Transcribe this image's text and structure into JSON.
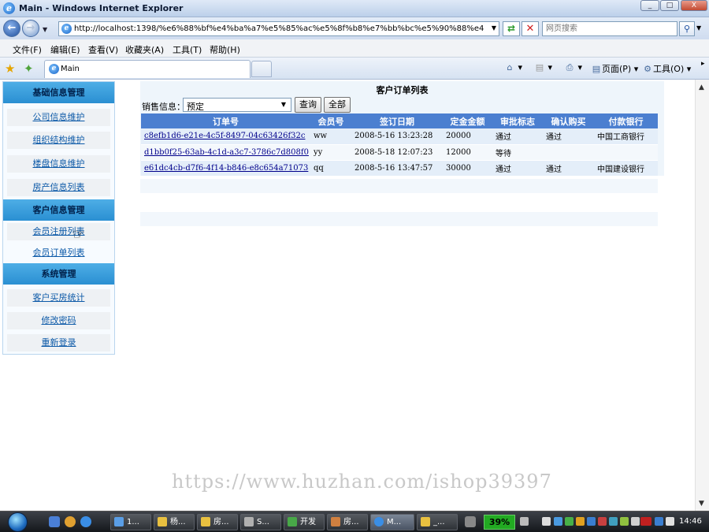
{
  "window": {
    "title": "Main - Windows Internet Explorer",
    "minimize": "_",
    "maximize": "□",
    "close": "X"
  },
  "address": {
    "url": "http://localhost:1398/%e6%88%bf%e4%ba%a7%e5%85%ac%e5%8f%b8%e7%bb%bc%e5%90%88%e4%bf%a1%e",
    "search_placeholder": "网页搜索"
  },
  "menu": [
    "文件(F)",
    "编辑(E)",
    "查看(V)",
    "收藏夹(A)",
    "工具(T)",
    "帮助(H)"
  ],
  "tab": {
    "title": "Main"
  },
  "commands": {
    "page": "页面(P)",
    "tools": "工具(O)"
  },
  "sidebar": {
    "sections": [
      {
        "title": "基础信息管理",
        "items": [
          "公司信息维护",
          "组织结构维护",
          "楼盘信息维护",
          "房产信息列表"
        ]
      },
      {
        "title": "客户信息管理",
        "items": [
          "会员注册列表",
          "会员订单列表"
        ]
      },
      {
        "title": "系统管理",
        "items": [
          "客户买房统计",
          "修改密码",
          "重新登录"
        ]
      }
    ]
  },
  "main": {
    "title": "客户订单列表",
    "filter_label": "销售信息：",
    "filter_value": "预定",
    "query_button": "查询",
    "all_button": "全部",
    "columns": [
      "订单号",
      "会员号",
      "签订日期",
      "定金金额",
      "审批标志",
      "确认购买",
      "付款银行"
    ],
    "rows": [
      [
        "c8efb1d6-e21e-4c5f-8497-04c63426f32c",
        "ww",
        "2008-5-16 13:23:28",
        "20000",
        "通过",
        "通过",
        "中国工商银行"
      ],
      [
        "d1bb0f25-63ab-4c1d-a3c7-3786c7d808f0",
        "yy",
        "2008-5-18 12:07:23",
        "12000",
        "等待",
        "",
        ""
      ],
      [
        "e61dc4cb-d7f6-4f14-b846-e8c654a71073",
        "qq",
        "2008-5-16 13:47:57",
        "30000",
        "通过",
        "通过",
        "中国建设银行"
      ]
    ]
  },
  "watermark": "https://www.huzhan.com/ishop39397",
  "taskbar": {
    "items": [
      "1...",
      "杨...",
      "房...",
      "S...",
      "开发",
      "房...",
      "M...",
      "_..."
    ],
    "cpu": "39%",
    "clock": "14:46"
  }
}
